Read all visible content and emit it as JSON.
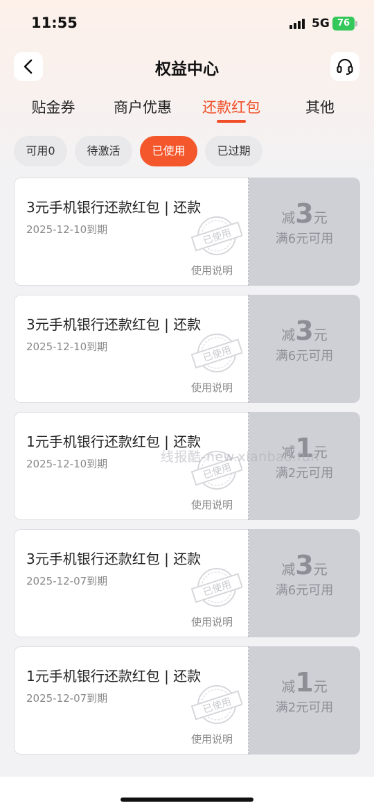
{
  "status_bar": {
    "time": "11:55",
    "network": "5G",
    "battery": "76"
  },
  "nav": {
    "title": "权益中心",
    "back_icon": "chevron-left-icon",
    "service_icon": "headset-icon"
  },
  "tabs": [
    {
      "label": "贴金券"
    },
    {
      "label": "商户优惠"
    },
    {
      "label": "还款红包",
      "active": true
    },
    {
      "label": "其他"
    }
  ],
  "filters": [
    {
      "label": "可用0"
    },
    {
      "label": "待激活"
    },
    {
      "label": "已使用",
      "active": true
    },
    {
      "label": "已过期"
    }
  ],
  "stamp_text": "已使用",
  "coupons": [
    {
      "title": "3元手机银行还款红包 | 还款",
      "expiry": "2025-12-10到期",
      "help": "使用说明",
      "prefix": "减",
      "amount": "3",
      "unit": "元",
      "condition": "满6元可用"
    },
    {
      "title": "3元手机银行还款红包 | 还款",
      "expiry": "2025-12-10到期",
      "help": "使用说明",
      "prefix": "减",
      "amount": "3",
      "unit": "元",
      "condition": "满6元可用"
    },
    {
      "title": "1元手机银行还款红包 | 还款",
      "expiry": "2025-12-10到期",
      "help": "使用说明",
      "prefix": "减",
      "amount": "1",
      "unit": "元",
      "condition": "满2元可用"
    },
    {
      "title": "3元手机银行还款红包 | 还款",
      "expiry": "2025-12-07到期",
      "help": "使用说明",
      "prefix": "减",
      "amount": "3",
      "unit": "元",
      "condition": "满6元可用"
    },
    {
      "title": "1元手机银行还款红包 | 还款",
      "expiry": "2025-12-07到期",
      "help": "使用说明",
      "prefix": "减",
      "amount": "1",
      "unit": "元",
      "condition": "满2元可用"
    }
  ],
  "watermark": "线报酷-new.xianbao.fun",
  "colors": {
    "accent": "#f04e26",
    "coupon_right_bg": "#cfd0d6"
  }
}
